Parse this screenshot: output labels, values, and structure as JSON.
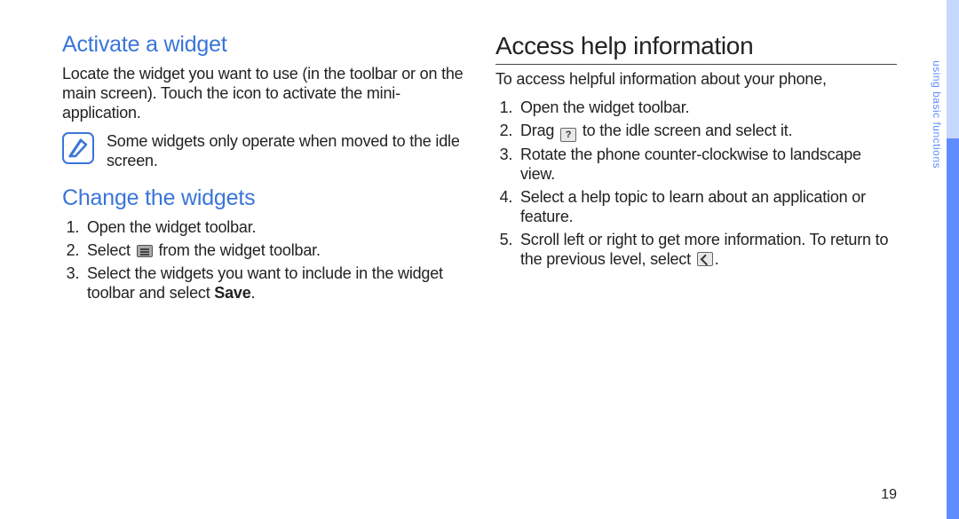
{
  "left": {
    "section1": {
      "title": "Activate a widget",
      "body": "Locate the widget you want to use (in the toolbar or on the main screen). Touch the icon to activate the mini-application.",
      "note": "Some widgets only operate when moved to the idle screen."
    },
    "section2": {
      "title": "Change the widgets",
      "steps": {
        "s1": "Open the widget toolbar.",
        "s2a": "Select ",
        "s2b": " from the widget toolbar.",
        "s3a": "Select the widgets you want to include in the widget toolbar and select ",
        "s3b": "Save",
        "s3c": "."
      }
    }
  },
  "right": {
    "title": "Access help information",
    "intro": "To access helpful information about your phone,",
    "steps": {
      "s1": "Open the widget toolbar.",
      "s2a": "Drag ",
      "s2b": " to the idle screen and select it.",
      "s3": "Rotate the phone counter-clockwise to landscape view.",
      "s4": "Select a help topic to learn about an application or feature.",
      "s5a": "Scroll left or right to get more information. To return to the previous level, select ",
      "s5b": "."
    }
  },
  "sideTab": "using basic functions",
  "pageNumber": "19"
}
